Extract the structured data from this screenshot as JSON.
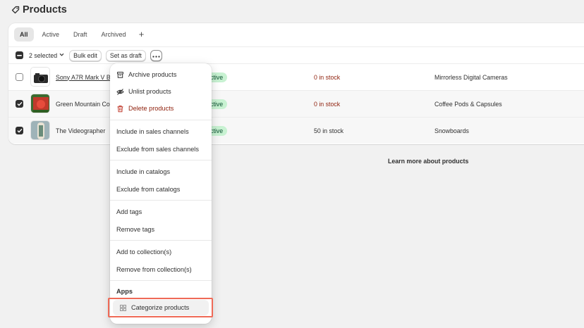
{
  "page": {
    "title": "Products",
    "icon": "tag-icon"
  },
  "tabs": [
    {
      "label": "All",
      "active": true
    },
    {
      "label": "Active",
      "active": false
    },
    {
      "label": "Draft",
      "active": false
    },
    {
      "label": "Archived",
      "active": false
    }
  ],
  "tab_add_label": "+",
  "bulk": {
    "selected_label": "2 selected",
    "bulk_edit_label": "Bulk edit",
    "set_draft_label": "Set as draft",
    "more_icon": "ellipsis-icon"
  },
  "rows": [
    {
      "name": "Sony A7R Mark V B",
      "status": "ctive",
      "stock": "0 in stock",
      "type": "Mirrorless Digital Cameras",
      "checked": false
    },
    {
      "name": "Green Mountain Co",
      "status": "ctive",
      "stock": "0 in stock",
      "type": "Coffee Pods & Capsules",
      "checked": true
    },
    {
      "name": "The Videographer",
      "status": "ctive",
      "stock": "50 in stock",
      "type": "Snowboards",
      "checked": true
    }
  ],
  "footer": {
    "learn_more": "Learn more about products"
  },
  "menu": {
    "archive": "Archive products",
    "unlist": "Unlist products",
    "delete": "Delete products",
    "include_channels": "Include in sales channels",
    "exclude_channels": "Exclude from sales channels",
    "include_catalogs": "Include in catalogs",
    "exclude_catalogs": "Exclude from catalogs",
    "add_tags": "Add tags",
    "remove_tags": "Remove tags",
    "add_collections": "Add to collection(s)",
    "remove_collections": "Remove from collection(s)",
    "apps_label": "Apps",
    "categorize": "Categorize products"
  },
  "colors": {
    "danger": "#8e1f0b",
    "status_bg": "#c8f2d2",
    "highlight": "#ef6a57"
  }
}
